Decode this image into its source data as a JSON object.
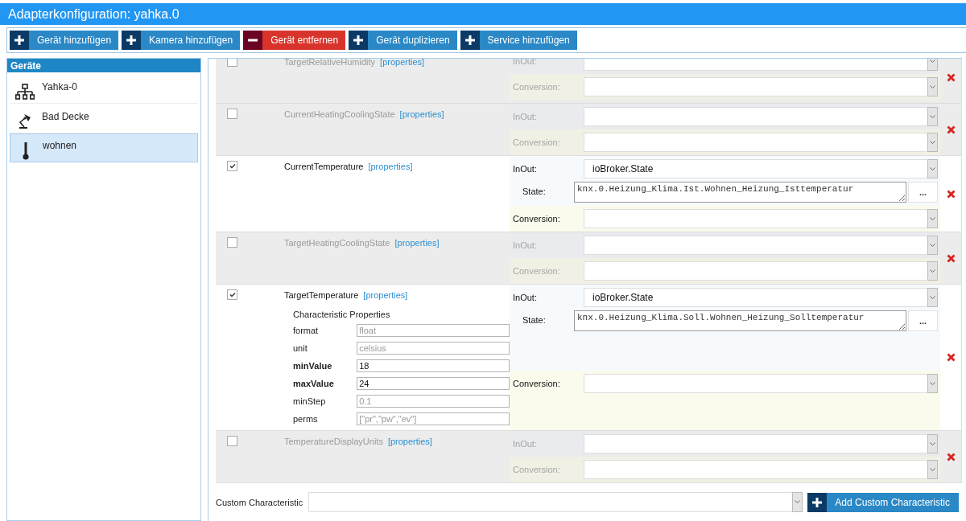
{
  "window": {
    "title": "Adapterkonfiguration: yahka.0"
  },
  "toolbar": [
    {
      "label": "Gerät hinzufügen",
      "kind": "add"
    },
    {
      "label": "Kamera hinzufügen",
      "kind": "add"
    },
    {
      "label": "Gerät entfernen",
      "kind": "remove"
    },
    {
      "label": "Gerät duplizieren",
      "kind": "add"
    },
    {
      "label": "Service hinzufügen",
      "kind": "add"
    }
  ],
  "devices": {
    "title": "Geräte",
    "items": [
      {
        "name": "Yahka-0",
        "kind": "bridge",
        "selected": false
      },
      {
        "name": "Bad Decke",
        "kind": "lamp",
        "selected": false
      },
      {
        "name": "wohnen",
        "kind": "thermometer",
        "selected": true
      }
    ]
  },
  "characteristics": [
    {
      "name": "TargetRelativeHumidity",
      "link": "[properties]",
      "enabled": false,
      "inout": {
        "label": "InOut:"
      },
      "conversion": {
        "label": "Conversion:"
      }
    },
    {
      "name": "CurrentHeatingCoolingState",
      "link": "[properties]",
      "enabled": false,
      "inout": {
        "label": "InOut:"
      },
      "conversion": {
        "label": "Conversion:"
      }
    },
    {
      "name": "CurrentTemperature",
      "link": "[properties]",
      "enabled": true,
      "inout": {
        "label": "InOut:",
        "value": "ioBroker.State"
      },
      "state": {
        "label": "State:",
        "value": "knx.0.Heizung_Klima.Ist.Wohnen_Heizung_Isttemperatur",
        "button": "..."
      },
      "conversion": {
        "label": "Conversion:"
      }
    },
    {
      "name": "TargetHeatingCoolingState",
      "link": "[properties]",
      "enabled": false,
      "inout": {
        "label": "InOut:"
      },
      "conversion": {
        "label": "Conversion:"
      }
    },
    {
      "name": "TargetTemperature",
      "link": "[properties]",
      "enabled": true,
      "inout": {
        "label": "InOut:",
        "value": "ioBroker.State"
      },
      "state": {
        "label": "State:",
        "value": "knx.0.Heizung_Klima.Soll.Wohnen_Heizung_Solltemperatur",
        "button": "..."
      },
      "conversion": {
        "label": "Conversion:"
      },
      "properties": {
        "title": "Characteristic Properties",
        "items": [
          {
            "name": "format",
            "placeholder": "float"
          },
          {
            "name": "unit",
            "placeholder": "celsius"
          },
          {
            "name": "minValue",
            "value": "18"
          },
          {
            "name": "maxValue",
            "value": "24"
          },
          {
            "name": "minStep",
            "placeholder": "0.1"
          },
          {
            "name": "perms",
            "placeholder": "[\"pr\",\"pw\",\"ev\"]"
          }
        ]
      }
    },
    {
      "name": "TemperatureDisplayUnits",
      "link": "[properties]",
      "enabled": false,
      "inout": {
        "label": "InOut:"
      },
      "conversion": {
        "label": "Conversion:"
      }
    }
  ],
  "custom": {
    "label": "Custom Characteristic",
    "button": "Add Custom Characteristic"
  }
}
